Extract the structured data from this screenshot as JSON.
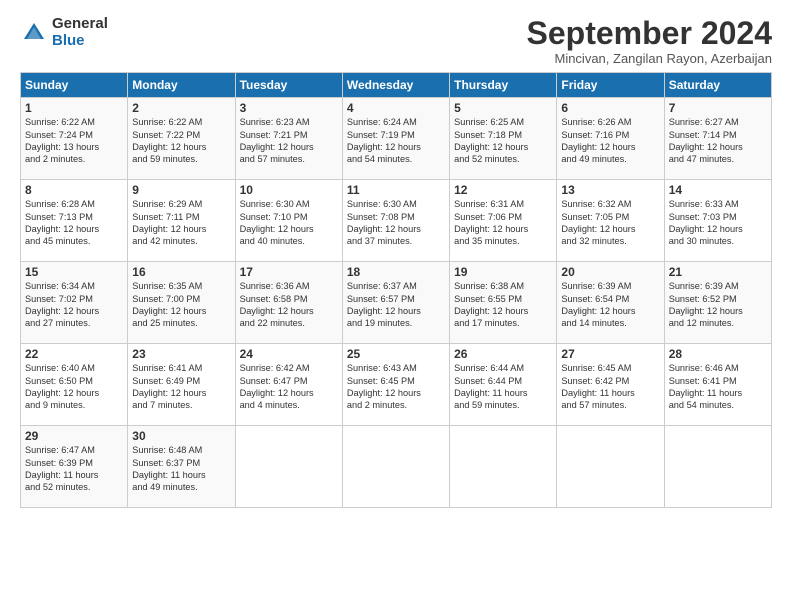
{
  "header": {
    "logo_general": "General",
    "logo_blue": "Blue",
    "month_title": "September 2024",
    "location": "Mincivan, Zangilan Rayon, Azerbaijan"
  },
  "weekdays": [
    "Sunday",
    "Monday",
    "Tuesday",
    "Wednesday",
    "Thursday",
    "Friday",
    "Saturday"
  ],
  "weeks": [
    [
      {
        "day": "1",
        "sunrise": "6:22 AM",
        "sunset": "7:24 PM",
        "daylight": "13 hours and 2 minutes."
      },
      {
        "day": "2",
        "sunrise": "6:22 AM",
        "sunset": "7:22 PM",
        "daylight": "12 hours and 59 minutes."
      },
      {
        "day": "3",
        "sunrise": "6:23 AM",
        "sunset": "7:21 PM",
        "daylight": "12 hours and 57 minutes."
      },
      {
        "day": "4",
        "sunrise": "6:24 AM",
        "sunset": "7:19 PM",
        "daylight": "12 hours and 54 minutes."
      },
      {
        "day": "5",
        "sunrise": "6:25 AM",
        "sunset": "7:18 PM",
        "daylight": "12 hours and 52 minutes."
      },
      {
        "day": "6",
        "sunrise": "6:26 AM",
        "sunset": "7:16 PM",
        "daylight": "12 hours and 49 minutes."
      },
      {
        "day": "7",
        "sunrise": "6:27 AM",
        "sunset": "7:14 PM",
        "daylight": "12 hours and 47 minutes."
      }
    ],
    [
      {
        "day": "8",
        "sunrise": "6:28 AM",
        "sunset": "7:13 PM",
        "daylight": "12 hours and 45 minutes."
      },
      {
        "day": "9",
        "sunrise": "6:29 AM",
        "sunset": "7:11 PM",
        "daylight": "12 hours and 42 minutes."
      },
      {
        "day": "10",
        "sunrise": "6:30 AM",
        "sunset": "7:10 PM",
        "daylight": "12 hours and 40 minutes."
      },
      {
        "day": "11",
        "sunrise": "6:30 AM",
        "sunset": "7:08 PM",
        "daylight": "12 hours and 37 minutes."
      },
      {
        "day": "12",
        "sunrise": "6:31 AM",
        "sunset": "7:06 PM",
        "daylight": "12 hours and 35 minutes."
      },
      {
        "day": "13",
        "sunrise": "6:32 AM",
        "sunset": "7:05 PM",
        "daylight": "12 hours and 32 minutes."
      },
      {
        "day": "14",
        "sunrise": "6:33 AM",
        "sunset": "7:03 PM",
        "daylight": "12 hours and 30 minutes."
      }
    ],
    [
      {
        "day": "15",
        "sunrise": "6:34 AM",
        "sunset": "7:02 PM",
        "daylight": "12 hours and 27 minutes."
      },
      {
        "day": "16",
        "sunrise": "6:35 AM",
        "sunset": "7:00 PM",
        "daylight": "12 hours and 25 minutes."
      },
      {
        "day": "17",
        "sunrise": "6:36 AM",
        "sunset": "6:58 PM",
        "daylight": "12 hours and 22 minutes."
      },
      {
        "day": "18",
        "sunrise": "6:37 AM",
        "sunset": "6:57 PM",
        "daylight": "12 hours and 19 minutes."
      },
      {
        "day": "19",
        "sunrise": "6:38 AM",
        "sunset": "6:55 PM",
        "daylight": "12 hours and 17 minutes."
      },
      {
        "day": "20",
        "sunrise": "6:39 AM",
        "sunset": "6:54 PM",
        "daylight": "12 hours and 14 minutes."
      },
      {
        "day": "21",
        "sunrise": "6:39 AM",
        "sunset": "6:52 PM",
        "daylight": "12 hours and 12 minutes."
      }
    ],
    [
      {
        "day": "22",
        "sunrise": "6:40 AM",
        "sunset": "6:50 PM",
        "daylight": "12 hours and 9 minutes."
      },
      {
        "day": "23",
        "sunrise": "6:41 AM",
        "sunset": "6:49 PM",
        "daylight": "12 hours and 7 minutes."
      },
      {
        "day": "24",
        "sunrise": "6:42 AM",
        "sunset": "6:47 PM",
        "daylight": "12 hours and 4 minutes."
      },
      {
        "day": "25",
        "sunrise": "6:43 AM",
        "sunset": "6:45 PM",
        "daylight": "12 hours and 2 minutes."
      },
      {
        "day": "26",
        "sunrise": "6:44 AM",
        "sunset": "6:44 PM",
        "daylight": "11 hours and 59 minutes."
      },
      {
        "day": "27",
        "sunrise": "6:45 AM",
        "sunset": "6:42 PM",
        "daylight": "11 hours and 57 minutes."
      },
      {
        "day": "28",
        "sunrise": "6:46 AM",
        "sunset": "6:41 PM",
        "daylight": "11 hours and 54 minutes."
      }
    ],
    [
      {
        "day": "29",
        "sunrise": "6:47 AM",
        "sunset": "6:39 PM",
        "daylight": "11 hours and 52 minutes."
      },
      {
        "day": "30",
        "sunrise": "6:48 AM",
        "sunset": "6:37 PM",
        "daylight": "11 hours and 49 minutes."
      },
      null,
      null,
      null,
      null,
      null
    ]
  ]
}
